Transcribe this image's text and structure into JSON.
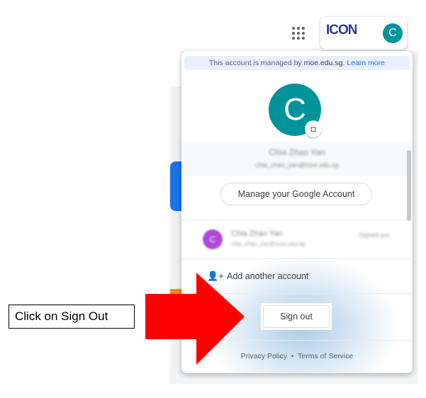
{
  "header": {
    "apps_icon": "grid-apps-icon",
    "logo_text": "ICON",
    "avatar_initial": "C"
  },
  "popup": {
    "banner": {
      "text": "This account is managed by ",
      "domain": "moe.edu.sg.",
      "learn_more": "Learn more"
    },
    "avatar_initial": "C",
    "camera_icon": "camera-icon",
    "name": "Chia Zhao Yan",
    "email": "chia_zhao_yan@moe.edu.sg",
    "manage_label": "Manage your Google Account",
    "other_account": {
      "initial": "C",
      "name": "Chia Zhao Yan",
      "email": "chia_zhao_yan@xxxx.edu.sg",
      "status": "Signed out"
    },
    "add_account_label": "Add another account",
    "sign_out_label": "Sign out",
    "privacy": "Privacy Policy",
    "separator": "•",
    "terms": "Terms of Service"
  },
  "annotation": {
    "callout": "Click on Sign Out",
    "arrow_color": "#ff0000"
  },
  "colors": {
    "avatar": "#00939a",
    "link": "#1a73e8"
  }
}
